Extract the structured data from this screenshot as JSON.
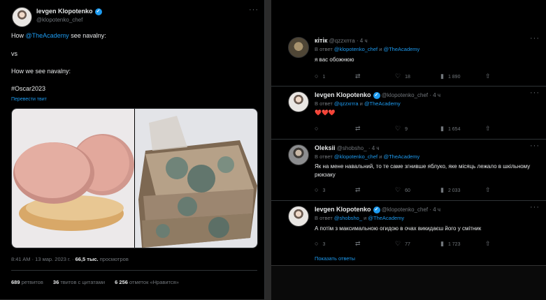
{
  "left_tweet": {
    "author_name": "Ievgen Klopotenko",
    "author_handle": "@klopotenko_chef",
    "lines": [
      {
        "pre": "How ",
        "mention": "@TheAcademy",
        "post": " see navalny:"
      },
      {
        "text": "vs"
      },
      {
        "text": "How we see navalny:"
      },
      {
        "hashtag": "#Oscar2023"
      }
    ],
    "translate_label": "Перевести твит",
    "meta_time": "8:41 AM · 13 мар. 2023 г. · ",
    "meta_views": "66,5 тыс.",
    "meta_views_label": " просмотров",
    "stats": [
      {
        "value": "689",
        "label": " ретвитов"
      },
      {
        "value": "36",
        "label": " твитов с цитатами"
      },
      {
        "value": "6 256",
        "label": " отметок «Нравится»"
      }
    ]
  },
  "replies": [
    {
      "name": "кітік",
      "handle": "@qzzxrrra",
      "time": "· 4 ч",
      "verified": false,
      "reply_prefix": "В ответ ",
      "to1": "@klopotenko_chef",
      "and": " и ",
      "to2": "@TheAcademy",
      "text": "я вас обожнюю",
      "counts": {
        "replies": "1",
        "retweets": "",
        "likes": "18",
        "views": "1 890"
      }
    },
    {
      "name": "Ievgen Klopotenko",
      "handle": "@klopotenko_chef",
      "time": "· 4 ч",
      "verified": true,
      "reply_prefix": "В ответ ",
      "to1": "@qzzxrrra",
      "and": " и ",
      "to2": "@TheAcademy",
      "text": "❤️❤️❤️",
      "counts": {
        "replies": "",
        "retweets": "",
        "likes": "9",
        "views": "1 654"
      }
    },
    {
      "name": "Oleksii",
      "handle": "@shobsho_",
      "time": "· 4 ч",
      "verified": false,
      "reply_prefix": "В ответ ",
      "to1": "@klopotenko_chef",
      "and": " и ",
      "to2": "@TheAcademy",
      "text": "Як на мене навальний, то те саме згнивше яблуко, яке місяць лежало в шкільному рюкзаку",
      "counts": {
        "replies": "3",
        "retweets": "",
        "likes": "60",
        "views": "2 033"
      }
    },
    {
      "name": "Ievgen Klopotenko",
      "handle": "@klopotenko_chef",
      "time": "· 4 ч",
      "verified": true,
      "reply_prefix": "В ответ ",
      "to1": "@shobsho_",
      "and": " и ",
      "to2": "@TheAcademy",
      "text": "А потім з максимальною огидою в очах викидаєш його у смітник",
      "counts": {
        "replies": "3",
        "retweets": "",
        "likes": "77",
        "views": "1 723"
      }
    }
  ],
  "show_more_label": "Показать ответы",
  "icons": {
    "reply": "reply-icon",
    "retweet": "retweet-icon",
    "like": "like-icon",
    "views": "views-icon",
    "share": "share-icon",
    "more": "more-icon"
  },
  "colors": {
    "link": "#1d9bf0",
    "verified": "#1d9bf0",
    "background": "#000000"
  }
}
